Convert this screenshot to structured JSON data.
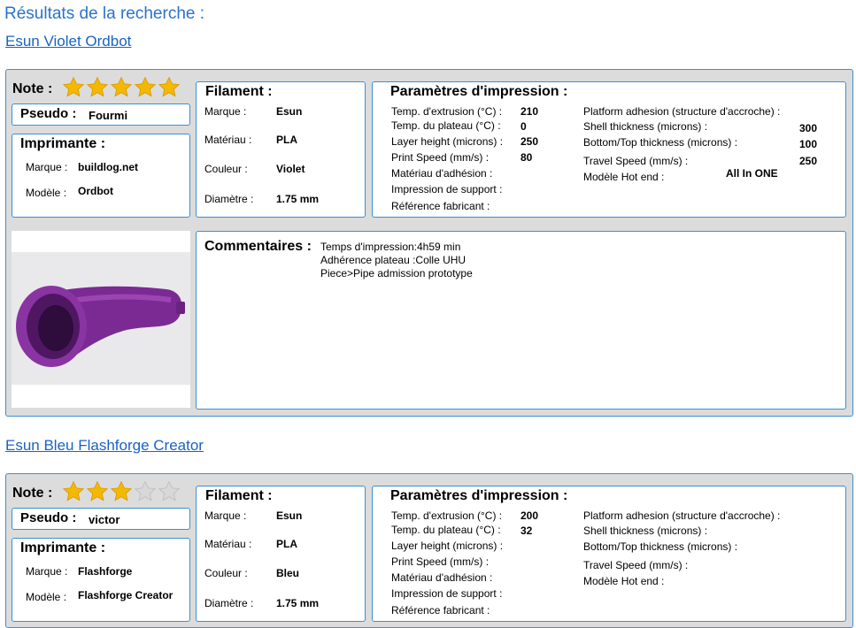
{
  "page": {
    "title": "Résultats de la recherche :"
  },
  "labels": {
    "note": "Note :",
    "pseudo": "Pseudo :",
    "imprimante": "Imprimante :",
    "marque_printer": "Marque :",
    "modele_printer": "Modèle :",
    "filament": "Filament :",
    "marque": "Marque :",
    "materiau": "Matériau :",
    "couleur": "Couleur :",
    "diametre": "Diamètre :",
    "params": "Paramètres d'impression :",
    "temp_extrusion": "Temp. d'extrusion (°C) :",
    "temp_plateau": "Temp. du plateau (°C) :",
    "layer_height": "Layer height (microns) :",
    "print_speed": "Print Speed (mm/s) :",
    "materiau_adhesion": "Matériau d'adhésion :",
    "impression_support": "Impression de support :",
    "reference_fabricant": "Référence fabricant :",
    "platform_adhesion": "Platform adhesion (structure d'accroche) :",
    "shell_thickness": "Shell thickness (microns) :",
    "bottom_top": "Bottom/Top thickness (microns) :",
    "travel_speed": "Travel Speed (mm/s) :",
    "hot_end": "Modèle Hot end :",
    "commentaires": "Commentaires :"
  },
  "results": [
    {
      "title": "Esun Violet Ordbot",
      "rating": 5,
      "rating_max": 5,
      "pseudo": "Fourmi",
      "printer": {
        "marque": "buildlog.net",
        "modele": "Ordbot"
      },
      "filament": {
        "marque": "Esun",
        "materiau": "PLA",
        "couleur": "Violet",
        "diametre": "1.75 mm"
      },
      "params": {
        "temp_extrusion": "210",
        "temp_plateau": "0",
        "layer_height": "250",
        "print_speed": "80",
        "materiau_adhesion": "",
        "impression_support": "",
        "reference_fabricant": "",
        "platform_adhesion": "",
        "shell_thickness": "300",
        "bottom_top": "100",
        "travel_speed": "250",
        "hot_end": "All In ONE"
      },
      "comments": [
        "Temps d'impression:4h59 min",
        "Adhérence plateau :Colle UHU",
        "Piece>Pipe admission prototype"
      ],
      "photo": "purple-printed-pipe"
    },
    {
      "title": "Esun Bleu Flashforge Creator",
      "rating": 3,
      "rating_max": 5,
      "pseudo": "victor",
      "printer": {
        "marque": "Flashforge",
        "modele": "Flashforge Creator"
      },
      "filament": {
        "marque": "Esun",
        "materiau": "PLA",
        "couleur": "Bleu",
        "diametre": "1.75 mm"
      },
      "params": {
        "temp_extrusion": "200",
        "temp_plateau": "32",
        "layer_height": "",
        "print_speed": "",
        "materiau_adhesion": "",
        "impression_support": "",
        "reference_fabricant": "",
        "platform_adhesion": "",
        "shell_thickness": "",
        "bottom_top": "",
        "travel_speed": "",
        "hot_end": ""
      },
      "comments": []
    }
  ],
  "colors": {
    "accent": "#3b8fd4",
    "link": "#1a62c4",
    "card_bg": "#dcdcdc",
    "star_on": "#f5b800",
    "star_off": "#d8d8d8"
  }
}
